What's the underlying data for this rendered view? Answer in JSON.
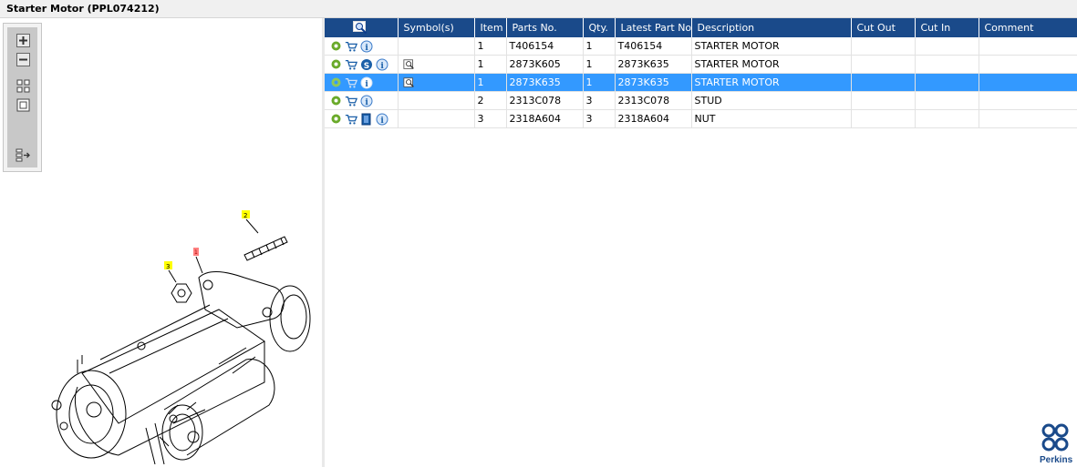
{
  "window": {
    "title": "Starter Motor (PPL074212)"
  },
  "drawing": {
    "callouts": [
      "1",
      "2",
      "3"
    ]
  },
  "table": {
    "columns": [
      "Symbol(s)",
      "Item",
      "Parts No.",
      "Qty.",
      "Latest Part No.",
      "Description",
      "Cut Out",
      "Cut In",
      "Comment"
    ],
    "rows": [
      {
        "item": "1",
        "part_no": "T406154",
        "qty": "1",
        "latest": "T406154",
        "description": "STARTER MOTOR",
        "cut_out": "",
        "cut_in": "",
        "comment": ""
      },
      {
        "item": "1",
        "part_no": "2873K605",
        "qty": "1",
        "latest": "2873K635",
        "description": "STARTER MOTOR",
        "cut_out": "",
        "cut_in": "",
        "comment": ""
      },
      {
        "item": "1",
        "part_no": "2873K635",
        "qty": "1",
        "latest": "2873K635",
        "description": "STARTER MOTOR",
        "cut_out": "",
        "cut_in": "",
        "comment": ""
      },
      {
        "item": "2",
        "part_no": "2313C078",
        "qty": "3",
        "latest": "2313C078",
        "description": "STUD",
        "cut_out": "",
        "cut_in": "",
        "comment": ""
      },
      {
        "item": "3",
        "part_no": "2318A604",
        "qty": "3",
        "latest": "2318A604",
        "description": "NUT",
        "cut_out": "",
        "cut_in": "",
        "comment": ""
      }
    ],
    "selected_row_index": 2
  },
  "brand": {
    "name": "Perkins"
  },
  "colors": {
    "header_bg": "#1a4a8a",
    "selected_bg": "#3399ff",
    "brand_blue": "#1a4a8a",
    "callout_yellow": "#ffff00",
    "callout_red": "#ff8080"
  }
}
